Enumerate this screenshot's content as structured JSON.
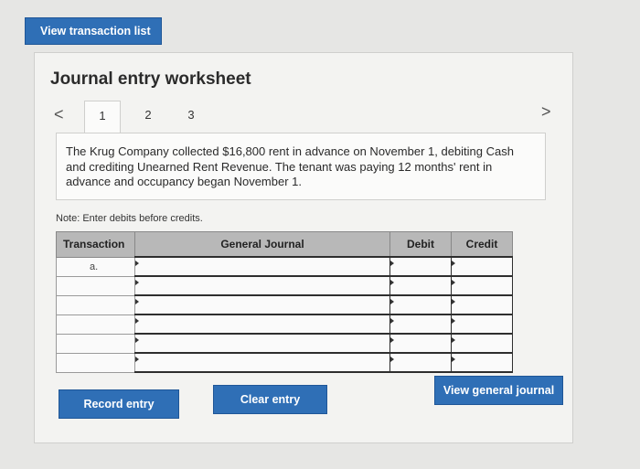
{
  "top": {
    "view_transaction_list": "View transaction list"
  },
  "worksheet": {
    "title": "Journal entry worksheet",
    "tabs": [
      "1",
      "2",
      "3"
    ],
    "prev_icon": "<",
    "next_icon": ">",
    "question": "The Krug Company collected $16,800 rent in advance on November 1, debiting Cash and crediting Unearned Rent Revenue. The tenant was paying 12 months' rent in advance and occupancy began November 1.",
    "note": "Note: Enter debits before credits."
  },
  "table": {
    "headers": {
      "transaction": "Transaction",
      "general_journal": "General Journal",
      "debit": "Debit",
      "credit": "Credit"
    },
    "rows": [
      {
        "transaction": "a.",
        "account": "",
        "debit": "",
        "credit": ""
      },
      {
        "transaction": "",
        "account": "",
        "debit": "",
        "credit": ""
      },
      {
        "transaction": "",
        "account": "",
        "debit": "",
        "credit": ""
      },
      {
        "transaction": "",
        "account": "",
        "debit": "",
        "credit": ""
      },
      {
        "transaction": "",
        "account": "",
        "debit": "",
        "credit": ""
      },
      {
        "transaction": "",
        "account": "",
        "debit": "",
        "credit": ""
      }
    ]
  },
  "buttons": {
    "record_entry": "Record entry",
    "clear_entry": "Clear entry",
    "view_general_journal": "View general journal"
  },
  "colors": {
    "button_blue": "#2f6fb6",
    "header_gray": "#b8b8b8"
  }
}
